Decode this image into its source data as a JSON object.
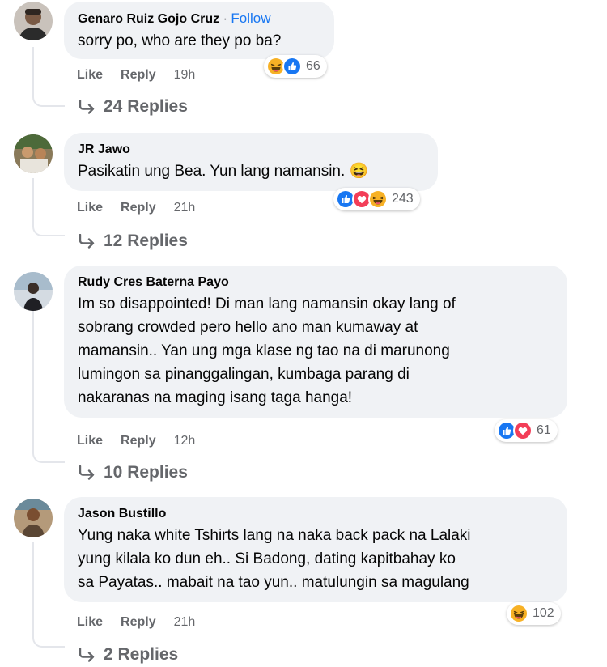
{
  "comments": [
    {
      "author": "Genaro Ruiz Gojo Cruz",
      "follow_sep": "·",
      "follow": "Follow",
      "text": "sorry po, who are they po ba?",
      "reaction_count": "66",
      "like": "Like",
      "reply": "Reply",
      "time": "19h",
      "replies": "24 Replies",
      "reactions": [
        "haha",
        "like"
      ]
    },
    {
      "author": "JR Jawo",
      "text": "Pasikatin ung Bea. Yun lang namansin. 😆",
      "reaction_count": "243",
      "like": "Like",
      "reply": "Reply",
      "time": "21h",
      "replies": "12 Replies",
      "reactions": [
        "like",
        "love",
        "haha"
      ]
    },
    {
      "author": "Rudy Cres Baterna Payo",
      "text_lines": [
        "Im so disappointed! Di man lang namansin okay lang of",
        "sobrang crowded pero hello ano man kumaway at",
        "mamansin.. Yan ung mga klase ng tao na di marunong",
        "lumingon sa pinanggalingan, kumbaga parang di",
        "nakaranas na maging isang taga hanga!"
      ],
      "reaction_count": "61",
      "like": "Like",
      "reply": "Reply",
      "time": "12h",
      "replies": "10 Replies",
      "reactions": [
        "like",
        "love"
      ]
    },
    {
      "author": "Jason Bustillo",
      "text_lines": [
        "Yung naka white Tshirts lang na naka back pack na Lalaki",
        "yung kilala ko dun eh.. Si Badong, dating kapitbahay ko",
        "sa Payatas.. mabait na tao yun.. matulungin sa magulang"
      ],
      "reaction_count": "102",
      "like": "Like",
      "reply": "Reply",
      "time": "21h",
      "replies": "2 Replies",
      "reactions": [
        "haha"
      ]
    }
  ],
  "colors": {
    "like_blue": "#1877f2",
    "love_red": "#f33e58",
    "haha_yellow": "#f7b125",
    "bubble_bg": "#f0f2f5",
    "meta_gray": "#65676b"
  }
}
